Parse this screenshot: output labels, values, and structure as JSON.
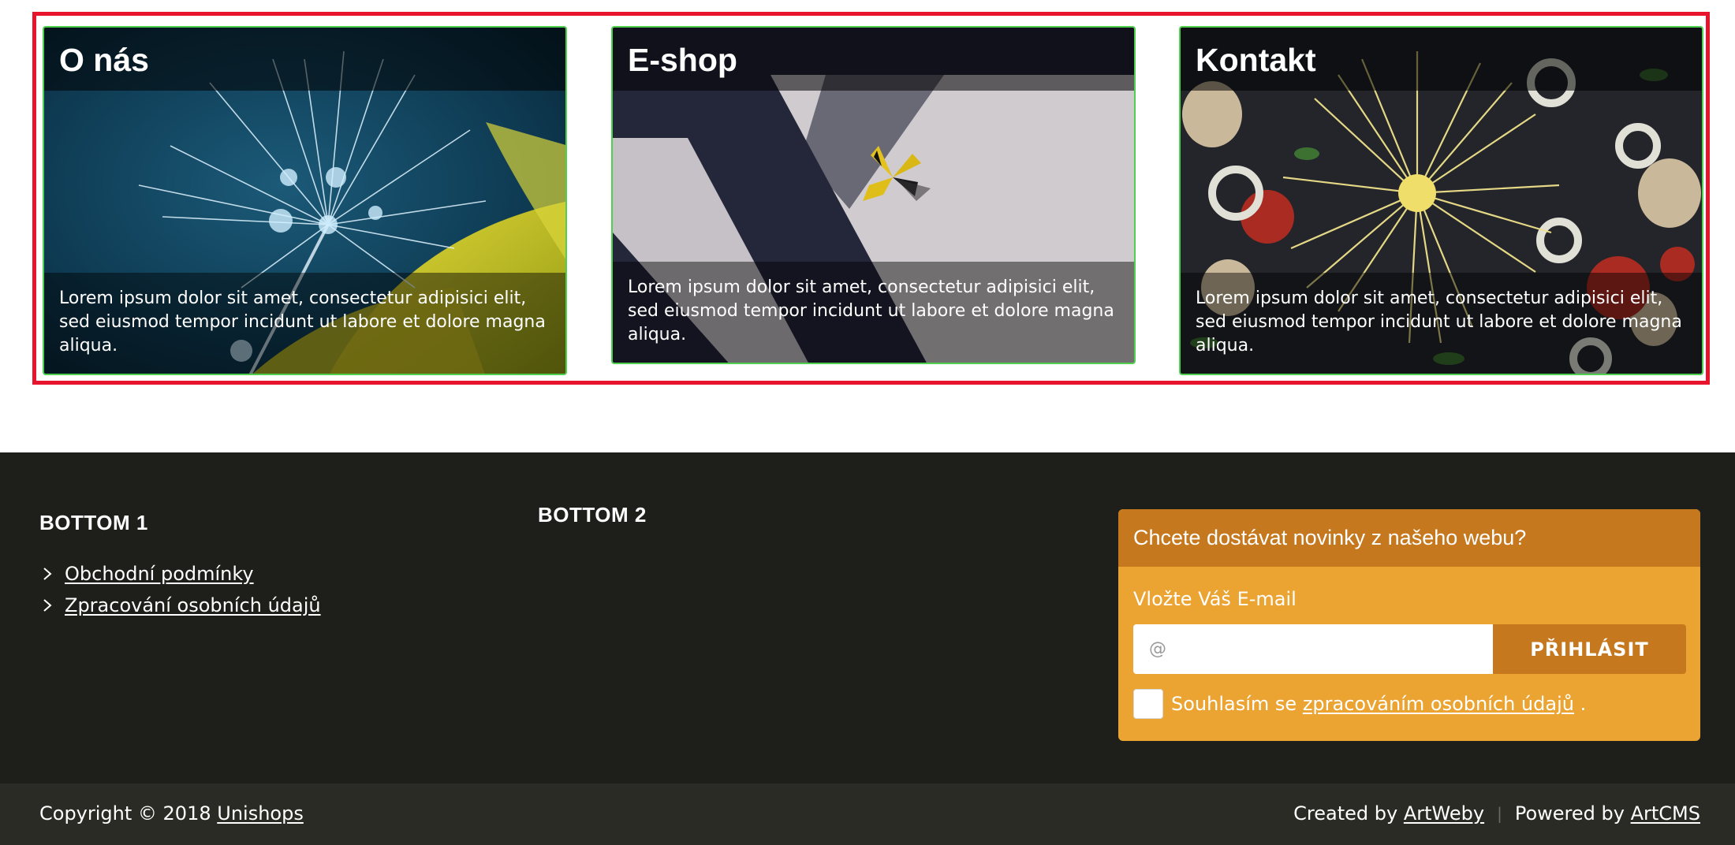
{
  "cards": [
    {
      "title": "O nás",
      "description": "Lorem ipsum dolor sit amet, consectetur adipisici elit, sed eiusmod tempor incidunt ut labore et dolore magna aliqua."
    },
    {
      "title": "E-shop",
      "description": "Lorem ipsum dolor sit amet, consectetur adipisici elit, sed eiusmod tempor incidunt ut labore et dolore magna aliqua."
    },
    {
      "title": "Kontakt",
      "description": "Lorem ipsum dolor sit amet, consectetur adipisici elit, sed eiusmod tempor incidunt ut labore et dolore magna aliqua."
    }
  ],
  "footer": {
    "col1": {
      "title": "BOTTOM 1",
      "links": [
        "Obchodní podmínky",
        "Zpracování osobních údajů"
      ]
    },
    "col2": {
      "title": "BOTTOM 2"
    },
    "newsletter": {
      "title": "Chcete dostávat novinky z našeho webu?",
      "label": "Vložte Váš E-mail",
      "placeholder": "@",
      "button": "PŘIHLÁSIT",
      "consent_prefix": "Souhlasím se",
      "consent_link": "zpracováním osobních údajů",
      "consent_suffix": "."
    },
    "bottom": {
      "copyright_prefix": "Copyright © 2018",
      "copyright_link": "Unishops",
      "created_prefix": "Created by",
      "created_link": "ArtWeby",
      "separator": "|",
      "powered_prefix": "Powered by",
      "powered_link": "ArtCMS"
    }
  },
  "colors": {
    "highlight_border": "#e8132c",
    "card_border": "#4fd14f",
    "footer_bg": "#1e1e1a",
    "footer_bottom_bg": "#2b2b25",
    "newsletter_bg": "#eba331",
    "newsletter_accent": "#c5781d"
  },
  "icons": {
    "link_bullet": "chevron-right-icon"
  }
}
